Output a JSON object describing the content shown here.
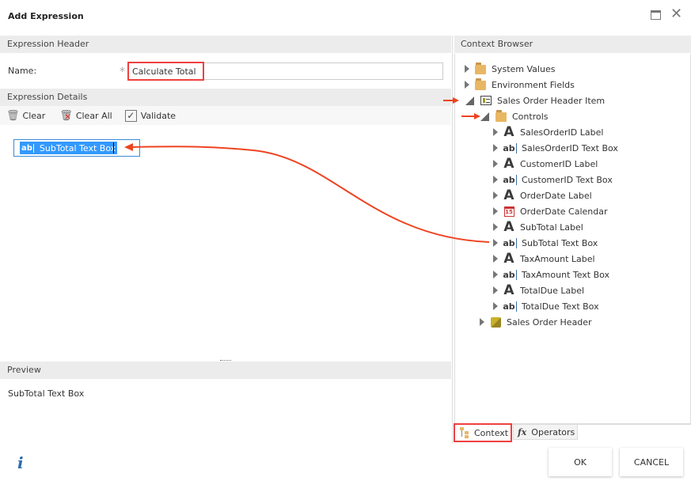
{
  "dialog": {
    "title": "Add Expression"
  },
  "header_section": {
    "title": "Expression Header",
    "name_label": "Name:",
    "required_mark": "*",
    "name_value": "Calculate Total"
  },
  "details_section": {
    "title": "Expression Details",
    "toolbar": {
      "clear": "Clear",
      "clear_all": "Clear All",
      "validate": "Validate"
    },
    "token": "SubTotal Text Box"
  },
  "preview_section": {
    "title": "Preview",
    "text": "SubTotal Text Box"
  },
  "context_browser": {
    "title": "Context Browser",
    "items": [
      {
        "label": "System Values",
        "icon": "folder-icon",
        "level": 0,
        "open": false
      },
      {
        "label": "Environment Fields",
        "icon": "folder-icon",
        "level": 0,
        "open": false
      },
      {
        "label": "Sales Order Header Item",
        "icon": "form-icon",
        "level": 0,
        "open": true
      },
      {
        "label": "Controls",
        "icon": "folder-icon",
        "level": 1,
        "open": true
      },
      {
        "label": "SalesOrderID Label",
        "icon": "label-icon",
        "level": 2
      },
      {
        "label": "SalesOrderID Text Box",
        "icon": "textbox-icon",
        "level": 2
      },
      {
        "label": "CustomerID Label",
        "icon": "label-icon",
        "level": 2
      },
      {
        "label": "CustomerID Text Box",
        "icon": "textbox-icon",
        "level": 2
      },
      {
        "label": "OrderDate Label",
        "icon": "label-icon",
        "level": 2
      },
      {
        "label": "OrderDate Calendar",
        "icon": "calendar-icon",
        "level": 2
      },
      {
        "label": "SubTotal Label",
        "icon": "label-icon",
        "level": 2
      },
      {
        "label": "SubTotal Text Box",
        "icon": "textbox-icon",
        "level": 2
      },
      {
        "label": "TaxAmount Label",
        "icon": "label-icon",
        "level": 2
      },
      {
        "label": "TaxAmount Text Box",
        "icon": "textbox-icon",
        "level": 2
      },
      {
        "label": "TotalDue Label",
        "icon": "label-icon",
        "level": 2
      },
      {
        "label": "TotalDue Text Box",
        "icon": "textbox-icon",
        "level": 2
      },
      {
        "label": "Sales Order Header",
        "icon": "cube-icon",
        "level": 1,
        "open": false
      }
    ]
  },
  "tabs": {
    "context": "Context",
    "operators": "Operators",
    "fx": "fx"
  },
  "footer": {
    "info": "i",
    "ok": "OK",
    "cancel": "CANCEL"
  },
  "calendar_day": "15",
  "colors": {
    "highlight": "#f04040",
    "selection": "#3399ff",
    "arrow": "#ee4422"
  }
}
